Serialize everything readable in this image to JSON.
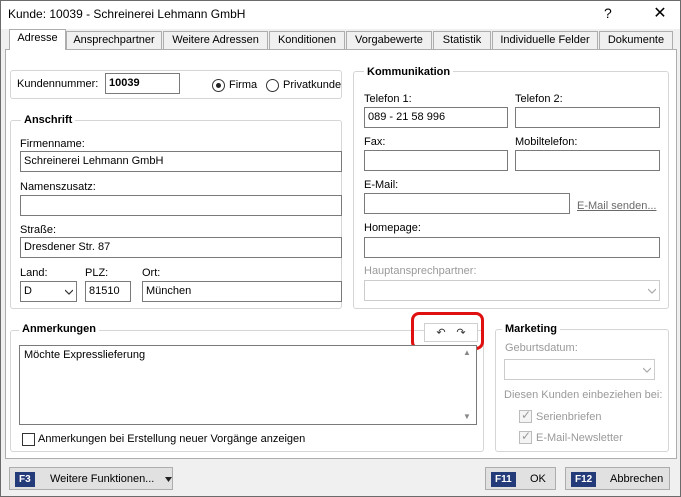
{
  "window": {
    "title": "Kunde: 10039 - Schreinerei Lehmann GmbH",
    "help_glyph": "?",
    "close_glyph": "✕"
  },
  "tabs": [
    {
      "label": "Adresse"
    },
    {
      "label": "Ansprechpartner"
    },
    {
      "label": "Weitere Adressen"
    },
    {
      "label": "Konditionen"
    },
    {
      "label": "Vorgabewerte"
    },
    {
      "label": "Statistik"
    },
    {
      "label": "Individuelle Felder"
    },
    {
      "label": "Dokumente"
    }
  ],
  "customer": {
    "number_label": "Kundennummer:",
    "number": "10039",
    "type_company": "Firma",
    "type_private": "Privatkunde",
    "selected_type": "Firma"
  },
  "address": {
    "legend": "Anschrift",
    "company_label": "Firmenname:",
    "company": "Schreinerei Lehmann GmbH",
    "suffix_label": "Namenszusatz:",
    "suffix": "",
    "street_label": "Straße:",
    "street": "Dresdener Str. 87",
    "country_label": "Land:",
    "country": "D",
    "zip_label": "PLZ:",
    "zip": "81510",
    "city_label": "Ort:",
    "city": "München"
  },
  "communication": {
    "legend": "Kommunikation",
    "phone1_label": "Telefon 1:",
    "phone1": "089 - 21 58 996",
    "phone2_label": "Telefon 2:",
    "phone2": "",
    "fax_label": "Fax:",
    "fax": "",
    "mobile_label": "Mobiltelefon:",
    "mobile": "",
    "email_label": "E-Mail:",
    "email": "",
    "email_send": "E-Mail senden...",
    "homepage_label": "Homepage:",
    "homepage": "",
    "main_contact_label": "Hauptansprechpartner:",
    "main_contact": ""
  },
  "notes": {
    "legend": "Anmerkungen",
    "text": "Möchte Expresslieferung",
    "show_checkbox_label": "Anmerkungen bei Erstellung neuer Vorgänge anzeigen",
    "show_checked": false,
    "undo_glyph": "↶",
    "redo_glyph": "↷"
  },
  "marketing": {
    "legend": "Marketing",
    "birthday_label": "Geburtsdatum:",
    "birthday": "",
    "include_label": "Diesen Kunden einbeziehen bei:",
    "serial_letters": "Serienbriefen",
    "newsletter": "E-Mail-Newsletter",
    "serial_checked": true,
    "newsletter_checked": true
  },
  "footer": {
    "more_key": "F3",
    "more_label": "Weitere Funktionen...",
    "ok_key": "F11",
    "ok_label": "OK",
    "cancel_key": "F12",
    "cancel_label": "Abbrechen"
  },
  "icons": {
    "dropdown": "chevron-down-icon",
    "undo": "undo-icon",
    "redo": "redo-icon",
    "close": "close-icon",
    "help": "help-icon"
  },
  "colors": {
    "fkey_badge": "#243b7a",
    "highlight": "#e01010",
    "link": "#6a6a6a"
  }
}
